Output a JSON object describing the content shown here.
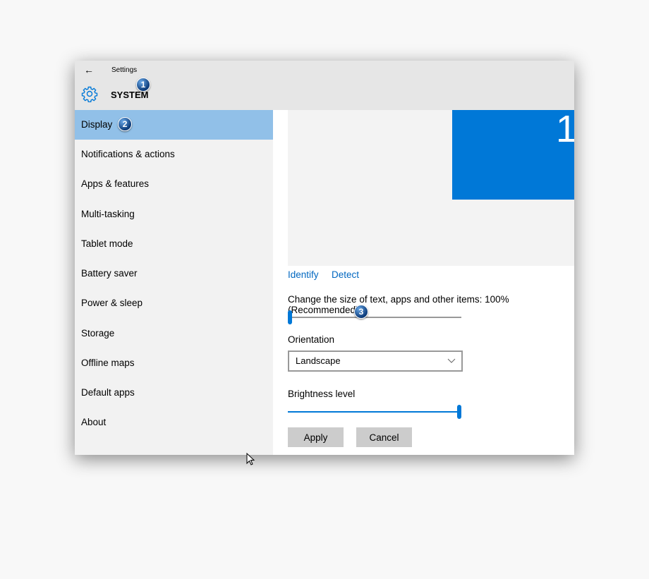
{
  "window": {
    "title": "Settings",
    "back_icon": "back-arrow-icon",
    "header_icon": "gear-icon",
    "header": "SYSTEM"
  },
  "annotations": [
    "1",
    "2",
    "3"
  ],
  "sidebar": {
    "active_index": 0,
    "items": [
      {
        "label": "Display"
      },
      {
        "label": "Notifications & actions"
      },
      {
        "label": "Apps & features"
      },
      {
        "label": "Multi-tasking"
      },
      {
        "label": "Tablet mode"
      },
      {
        "label": "Battery saver"
      },
      {
        "label": "Power & sleep"
      },
      {
        "label": "Storage"
      },
      {
        "label": "Offline maps"
      },
      {
        "label": "Default apps"
      },
      {
        "label": "About"
      }
    ]
  },
  "display": {
    "monitor_number": "1",
    "identify_label": "Identify",
    "detect_label": "Detect",
    "scale_label": "Change the size of text, apps and other items: 100% (Recommended)",
    "scale_slider_percent": 0,
    "orientation_label": "Orientation",
    "orientation_value": "Landscape",
    "brightness_label": "Brightness level",
    "brightness_percent": 100,
    "apply_label": "Apply",
    "cancel_label": "Cancel"
  },
  "colors": {
    "accent": "#0078d7",
    "link": "#0067c0",
    "selected_nav": "#91c0e8",
    "titlebar": "#e6e6e6",
    "sidebar": "#f2f2f2",
    "button": "#cccccc"
  }
}
